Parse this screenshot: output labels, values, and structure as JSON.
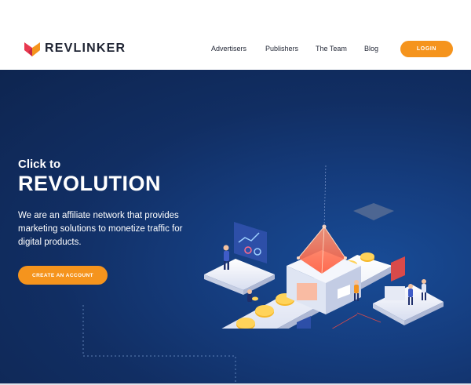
{
  "brand": {
    "name": "REVLINKER",
    "primary": "#f5941d",
    "dark": "#1f2433"
  },
  "nav": {
    "items": [
      {
        "label": "Advertisers"
      },
      {
        "label": "Publishers"
      },
      {
        "label": "The Team"
      },
      {
        "label": "Blog"
      }
    ],
    "login_label": "LOGIN"
  },
  "hero": {
    "kicker": "Click to",
    "title": "REVOLUTION",
    "description": "We are an affiliate network that provides marketing solutions to monetize traffic for digital products.",
    "cta_label": "CREATE AN ACCOUNT",
    "bg_top": "#0e2550",
    "bg_bottom": "#184c97"
  },
  "icons": [
    "revlinker-logo-icon",
    "coin-icon",
    "chart-screen-icon",
    "person-icon",
    "crystal-icon"
  ]
}
